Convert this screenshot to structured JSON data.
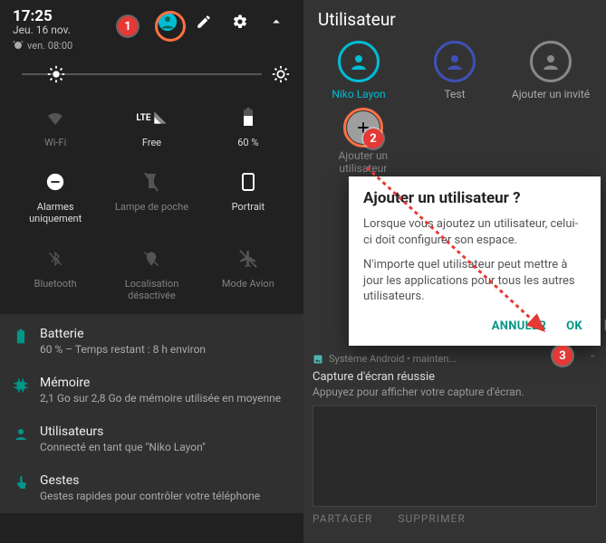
{
  "left": {
    "time": "17:25",
    "date": "Jeu. 16 nov.",
    "alarm": "ven. 08:00",
    "brightness_pct": 10,
    "tiles": [
      {
        "label": "Wi-Fi",
        "icon": "wifi-off"
      },
      {
        "label": "Free",
        "icon": "lte"
      },
      {
        "label": "60 %",
        "icon": "battery"
      },
      {
        "label": "Alarmes uniquement",
        "icon": "dnd-alarms"
      },
      {
        "label": "Lampe de poche",
        "icon": "flashlight-off"
      },
      {
        "label": "Portrait",
        "icon": "portrait"
      },
      {
        "label": "Bluetooth",
        "icon": "bluetooth-off"
      },
      {
        "label": "Localisation désactivée",
        "icon": "location-off"
      },
      {
        "label": "Mode Avion",
        "icon": "airplane-off"
      }
    ],
    "settings": [
      {
        "title": "Batterie",
        "sub": "60 % – Temps restant : 8 h environ",
        "icon": "battery"
      },
      {
        "title": "Mémoire",
        "sub": "2,1 Go sur 2,8 Go de mémoire utilisée en moyenne",
        "icon": "memory"
      },
      {
        "title": "Utilisateurs",
        "sub": "Connecté en tant que \"Niko Layon\"",
        "icon": "person"
      },
      {
        "title": "Gestes",
        "sub": "Gestes rapides pour contrôler votre téléphone",
        "icon": "gesture"
      }
    ]
  },
  "right": {
    "title": "Utilisateur",
    "users": [
      {
        "name": "Niko Layon",
        "kind": "active"
      },
      {
        "name": "Test",
        "kind": "test"
      },
      {
        "name": "Ajouter un invité",
        "kind": "guest"
      }
    ],
    "add_label": "Ajouter un utilisateur",
    "dialog": {
      "title": "Ajouter un utilisateur ?",
      "p1": "Lorsque vous ajoutez un utilisateur, celui-ci doit configurer son espace.",
      "p2": "N'importe quel utilisateur peut mettre à jour les applications pour tous les autres utilisateurs.",
      "cancel": "ANNULER",
      "ok": "OK"
    },
    "ok_ghost": "K",
    "notification": {
      "app": "Système Android • mainten...",
      "title": "Capture d'écran réussie",
      "sub": "Appuyez pour afficher votre capture d'écran.",
      "action1": "PARTAGER",
      "action2": "SUPPRIMER"
    }
  },
  "markers": {
    "m1": "1",
    "m2": "2",
    "m3": "3"
  }
}
